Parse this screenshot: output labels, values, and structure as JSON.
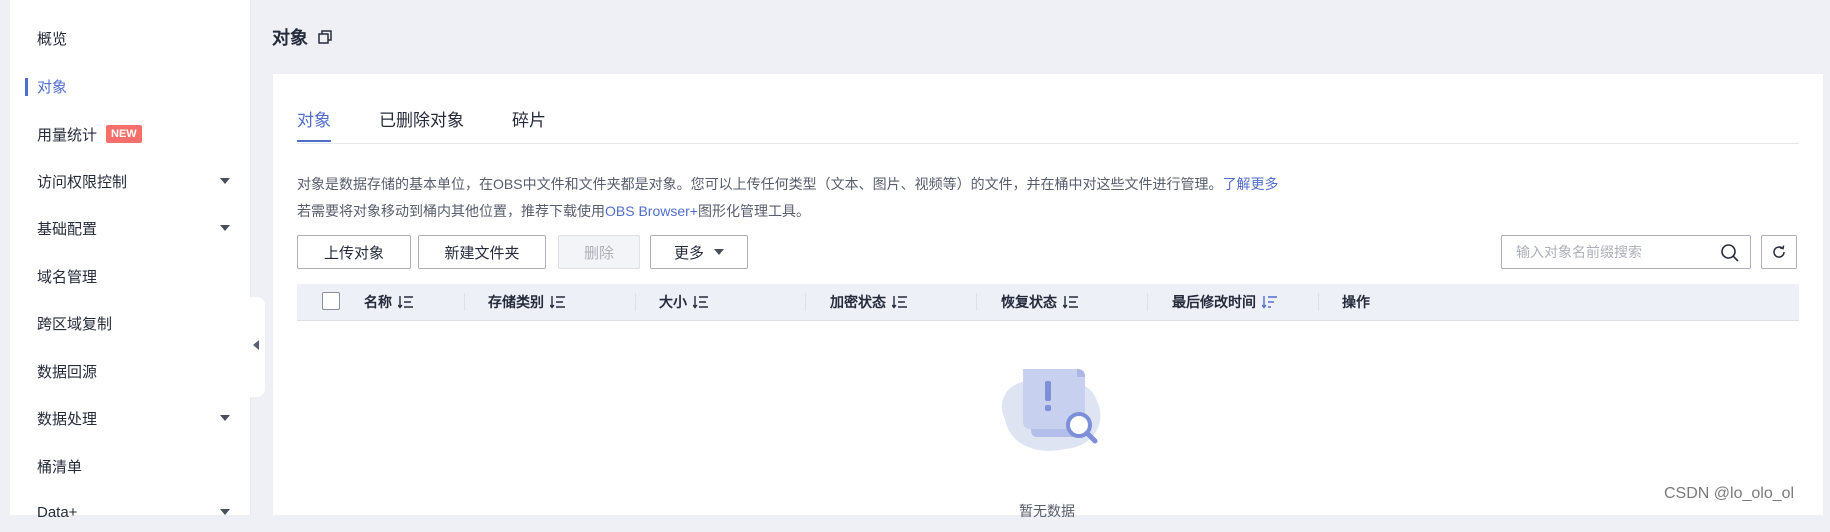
{
  "sidebar": {
    "items": [
      {
        "label": "概览"
      },
      {
        "label": "对象"
      },
      {
        "label": "用量统计",
        "badge": "NEW"
      },
      {
        "label": "访问权限控制"
      },
      {
        "label": "基础配置"
      },
      {
        "label": "域名管理"
      },
      {
        "label": "跨区域复制"
      },
      {
        "label": "数据回源"
      },
      {
        "label": "数据处理"
      },
      {
        "label": "桶清单"
      },
      {
        "label": "Data+"
      }
    ]
  },
  "header": {
    "title": "对象"
  },
  "tabs": [
    {
      "label": "对象"
    },
    {
      "label": "已删除对象"
    },
    {
      "label": "碎片"
    }
  ],
  "description": {
    "line1": "对象是数据存储的基本单位，在OBS中文件和文件夹都是对象。您可以上传任何类型（文本、图片、视频等）的文件，并在桶中对这些文件进行管理。",
    "line1_link": "了解更多",
    "line2_prefix": "若需要将对象移动到桶内其他位置，推荐下载使用",
    "line2_link": "OBS Browser+",
    "line2_suffix": "图形化管理工具。"
  },
  "toolbar": {
    "upload_label": "上传对象",
    "new_folder_label": "新建文件夹",
    "delete_label": "删除",
    "more_label": "更多",
    "search_placeholder": "输入对象名前缀搜索"
  },
  "table": {
    "columns": [
      "名称",
      "存储类别",
      "大小",
      "加密状态",
      "恢复状态",
      "最后修改时间",
      "操作"
    ]
  },
  "empty_state": {
    "text": "暂无数据"
  },
  "watermark": "CSDN @lo_olo_ol",
  "colors": {
    "accent": "#526ecc",
    "badge": "#f66f6a"
  }
}
